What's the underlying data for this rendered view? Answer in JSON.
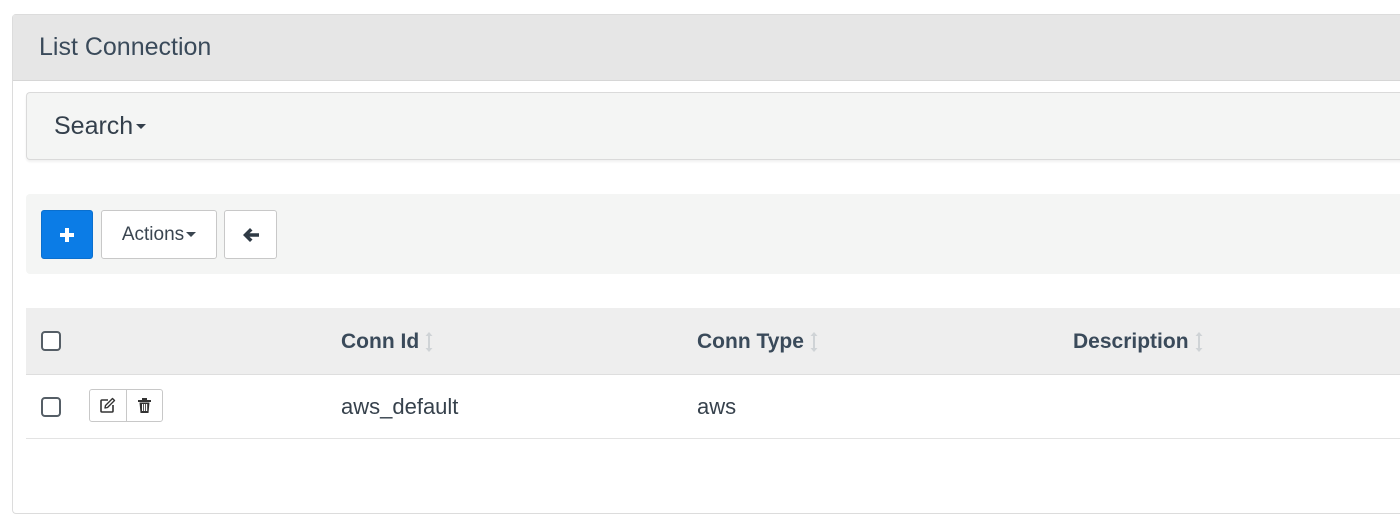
{
  "panel": {
    "title": "List Connection"
  },
  "search": {
    "label": "Search"
  },
  "toolbar": {
    "add_icon": "plus-icon",
    "actions_label": "Actions",
    "back_icon": "arrow-left-icon",
    "primary_color": "#0b7ce6"
  },
  "table": {
    "columns": [
      {
        "label": "Conn Id"
      },
      {
        "label": "Conn Type"
      },
      {
        "label": "Description"
      }
    ],
    "rows": [
      {
        "conn_id": "aws_default",
        "conn_type": "aws",
        "description": ""
      }
    ],
    "row_action_icons": [
      "edit-icon",
      "trash-icon"
    ]
  }
}
